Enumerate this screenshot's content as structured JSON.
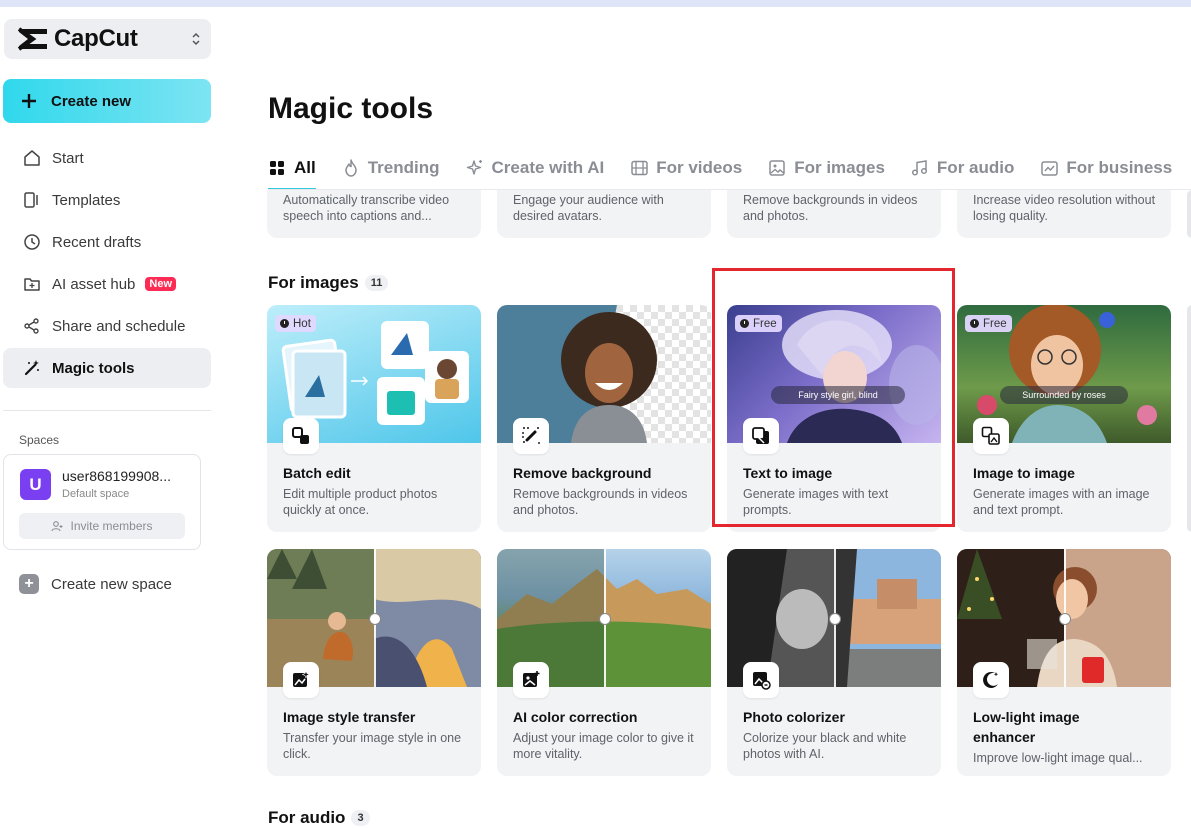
{
  "app": {
    "name": "CapCut"
  },
  "sidebar": {
    "create_label": "Create new",
    "items": [
      {
        "label": "Start",
        "icon": "home-icon"
      },
      {
        "label": "Templates",
        "icon": "templates-icon"
      },
      {
        "label": "Recent drafts",
        "icon": "clock-icon"
      },
      {
        "label": "AI asset hub",
        "icon": "asset-hub-icon",
        "badge": "New"
      },
      {
        "label": "Share and schedule",
        "icon": "share-icon"
      },
      {
        "label": "Magic tools",
        "icon": "magic-wand-icon",
        "active": true
      }
    ],
    "spaces_label": "Spaces",
    "space": {
      "avatar_letter": "U",
      "name": "user868199908...",
      "type": "Default space",
      "invite_label": "Invite members"
    },
    "new_space_label": "Create new space"
  },
  "main": {
    "title": "Magic tools",
    "tabs": [
      {
        "label": "All",
        "icon": "grid-icon",
        "active": true
      },
      {
        "label": "Trending",
        "icon": "flame-icon"
      },
      {
        "label": "Create with AI",
        "icon": "sparkle-icon"
      },
      {
        "label": "For videos",
        "icon": "film-icon"
      },
      {
        "label": "For images",
        "icon": "image-icon"
      },
      {
        "label": "For audio",
        "icon": "music-icon"
      },
      {
        "label": "For business",
        "icon": "business-icon"
      }
    ],
    "partial_row": [
      "Automatically transcribe video speech into captions and...",
      "Engage your audience with desired avatars.",
      "Remove backgrounds in videos and photos.",
      "Increase video resolution without losing quality."
    ],
    "images_section": {
      "title": "For images",
      "count": "11",
      "cards": [
        {
          "title": "Batch edit",
          "desc": "Edit multiple product photos quickly at once.",
          "badge": "Hot",
          "icon": "batch-edit-icon"
        },
        {
          "title": "Remove background",
          "desc": "Remove backgrounds in videos and photos.",
          "icon": "remove-bg-icon"
        },
        {
          "title": "Text to image",
          "desc": "Generate images with text prompts.",
          "badge": "Free",
          "prompt": "Fairy style girl, blind",
          "icon": "text-to-image-icon"
        },
        {
          "title": "Image to image",
          "desc": "Generate images with an image and text prompt.",
          "badge": "Free",
          "prompt": "Surrounded by roses",
          "icon": "image-to-image-icon"
        },
        {
          "title": "Image style transfer",
          "desc": "Transfer your image style in one click.",
          "icon": "style-transfer-icon"
        },
        {
          "title": "AI color correction",
          "desc": "Adjust your image color to give it more vitality.",
          "icon": "color-correction-icon"
        },
        {
          "title": "Photo colorizer",
          "desc": "Colorize your black and white photos with AI.",
          "icon": "colorizer-icon"
        },
        {
          "title": "Low-light image enhancer",
          "desc": "Improve low-light image qual...",
          "icon": "low-light-icon"
        }
      ]
    },
    "audio_section": {
      "title": "For audio",
      "count": "3"
    }
  },
  "colors": {
    "accent": "#30d8ec",
    "highlight": "#e4262f",
    "new_badge": "#fe2c55",
    "avatar": "#7b3ff2"
  }
}
